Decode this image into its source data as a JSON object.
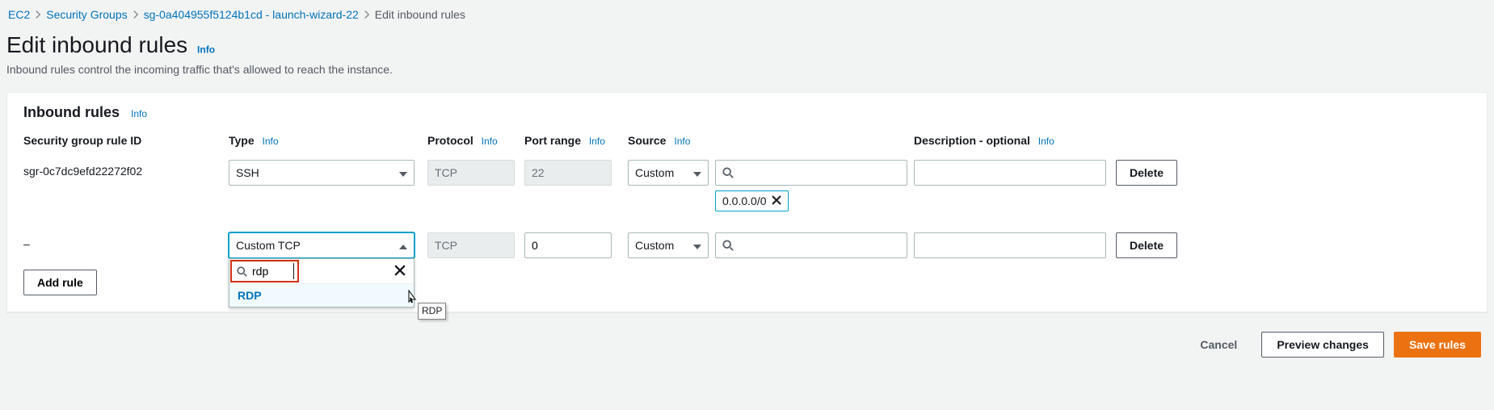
{
  "breadcrumb": {
    "ec2": "EC2",
    "sg": "Security Groups",
    "sgid": "sg-0a404955f5124b1cd - launch-wizard-22",
    "current": "Edit inbound rules"
  },
  "page": {
    "title": "Edit inbound rules",
    "info": "Info",
    "subtitle": "Inbound rules control the incoming traffic that's allowed to reach the instance."
  },
  "panel": {
    "title": "Inbound rules",
    "info": "Info"
  },
  "columns": {
    "ruleid": "Security group rule ID",
    "type": "Type",
    "protocol": "Protocol",
    "portrange": "Port range",
    "source": "Source",
    "description": "Description - optional",
    "info": "Info"
  },
  "rules": [
    {
      "id": "sgr-0c7dc9efd22272f02",
      "type": "SSH",
      "protocol": "TCP",
      "port": "22",
      "source_mode": "Custom",
      "source_val": "",
      "source_tag": "0.0.0.0/0",
      "description": ""
    },
    {
      "id": "–",
      "type": "Custom TCP",
      "protocol": "TCP",
      "port": "0",
      "source_mode": "Custom",
      "source_val": "",
      "description": ""
    }
  ],
  "dropdown": {
    "search": "rdp",
    "option": "RDP",
    "tooltip": "RDP"
  },
  "buttons": {
    "delete": "Delete",
    "addrule": "Add rule",
    "cancel": "Cancel",
    "preview": "Preview changes",
    "save": "Save rules"
  }
}
